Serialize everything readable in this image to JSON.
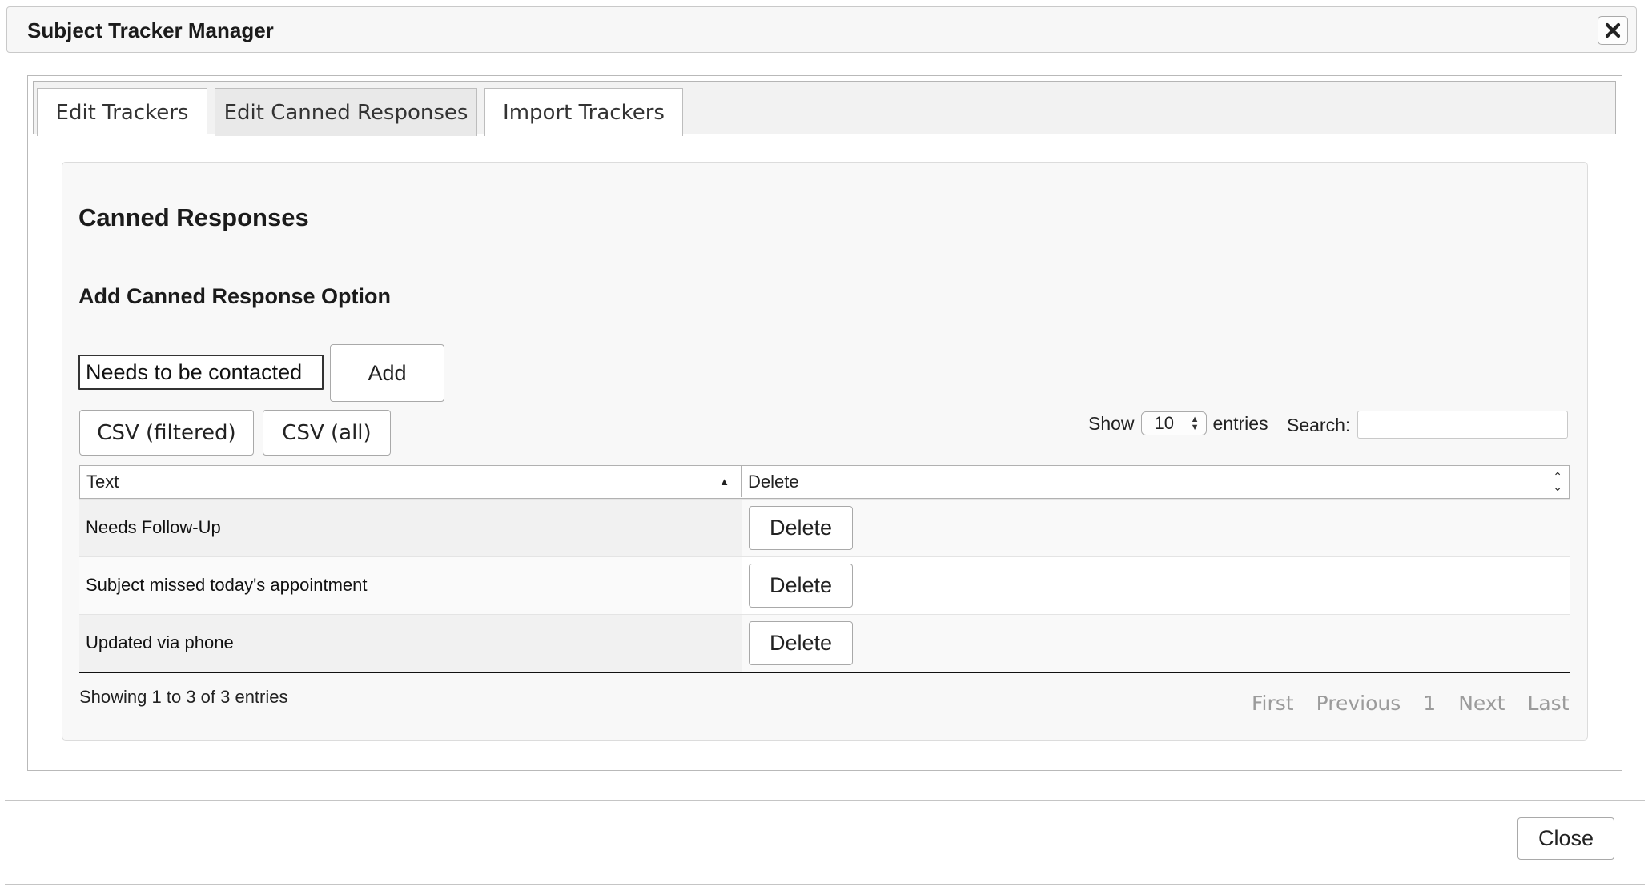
{
  "dialog": {
    "title": "Subject Tracker Manager",
    "close_icon": "close-icon"
  },
  "tabs": [
    {
      "label": "Edit Trackers",
      "active": false
    },
    {
      "label": "Edit Canned Responses",
      "active": true
    },
    {
      "label": "Import Trackers",
      "active": false
    }
  ],
  "panel": {
    "heading": "Canned Responses",
    "subheading": "Add Canned Response Option",
    "new_response_value": "Needs to be contacted",
    "add_label": "Add",
    "csv_filtered_label": "CSV (filtered)",
    "csv_all_label": "CSV (all)",
    "show_label": "Show",
    "entries_label": "entries",
    "page_length": "10",
    "search_label": "Search:",
    "search_value": ""
  },
  "table": {
    "columns": [
      "Text",
      "Delete"
    ],
    "rows": [
      {
        "text": "Needs Follow-Up",
        "action": "Delete"
      },
      {
        "text": "Subject missed today's appointment",
        "action": "Delete"
      },
      {
        "text": "Updated via phone",
        "action": "Delete"
      }
    ],
    "info": "Showing 1 to 3 of 3 entries",
    "pagination": [
      "First",
      "Previous",
      "1",
      "Next",
      "Last"
    ]
  },
  "footer": {
    "close_label": "Close"
  }
}
